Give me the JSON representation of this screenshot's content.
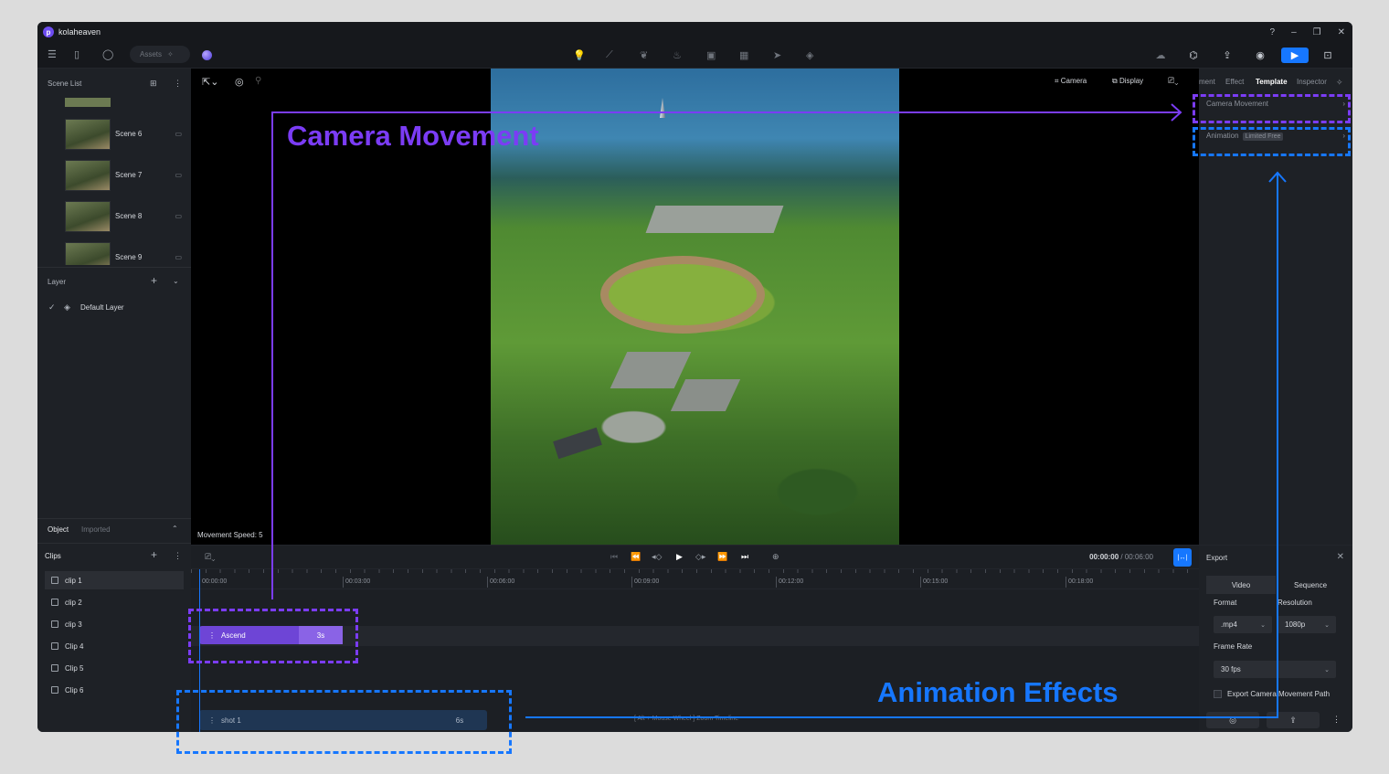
{
  "app": {
    "name": "kolaheaven",
    "logo_letter": "p"
  },
  "toolbar": {
    "assets_placeholder": "Assets"
  },
  "scene_list": {
    "title": "Scene List",
    "items": [
      {
        "label": "Scene 6"
      },
      {
        "label": "Scene 7"
      },
      {
        "label": "Scene 8"
      },
      {
        "label": "Scene 9"
      }
    ]
  },
  "layer": {
    "title": "Layer",
    "items": [
      {
        "label": "Default Layer"
      }
    ]
  },
  "object_tabs": {
    "active": "Object",
    "inactive": "Imported"
  },
  "clips": {
    "title": "Clips",
    "items": [
      {
        "label": "clip 1"
      },
      {
        "label": "clip 2"
      },
      {
        "label": "clip 3"
      },
      {
        "label": "Clip 4"
      },
      {
        "label": "Clip 5"
      },
      {
        "label": "Clip 6"
      }
    ]
  },
  "viewport": {
    "camera_label": "Camera",
    "display_label": "Display",
    "movement_speed": "Movement Speed: 5"
  },
  "right_panel": {
    "tabs": [
      {
        "label": "ment"
      },
      {
        "label": "Effect"
      },
      {
        "label": "Template"
      },
      {
        "label": "Inspector"
      }
    ],
    "rows": {
      "camera_movement": "Camera Movement",
      "animation": "Animation",
      "animation_tag": "Limited Free"
    }
  },
  "timeline": {
    "timecode_current": "00:00:00",
    "timecode_total": " / 00:06:00",
    "ticks": [
      "00:00:00",
      "00:03:00",
      "00:06:00",
      "00:09:00",
      "00:12:00",
      "00:15:00",
      "00:18:00"
    ],
    "track1": {
      "label": "Ascend",
      "duration": "3s"
    },
    "track2": {
      "label": "shot 1",
      "duration": "6s"
    },
    "hint": "[ Alt + Mouse Wheel ] Zoom Timeline"
  },
  "export": {
    "title": "Export",
    "tabs": {
      "video": "Video",
      "sequence": "Sequence"
    },
    "format_label": "Format",
    "format_value": ".mp4",
    "resolution_label": "Resolution",
    "resolution_value": "1080p",
    "frame_rate_label": "Frame Rate",
    "frame_rate_value": "30 fps",
    "export_path_label": "Export Camera Movement Path"
  },
  "annotations": {
    "camera_movement": "Camera Movement",
    "animation_effects": "Animation Effects",
    "purple": "#7b3cf5",
    "blue": "#1677ff"
  }
}
